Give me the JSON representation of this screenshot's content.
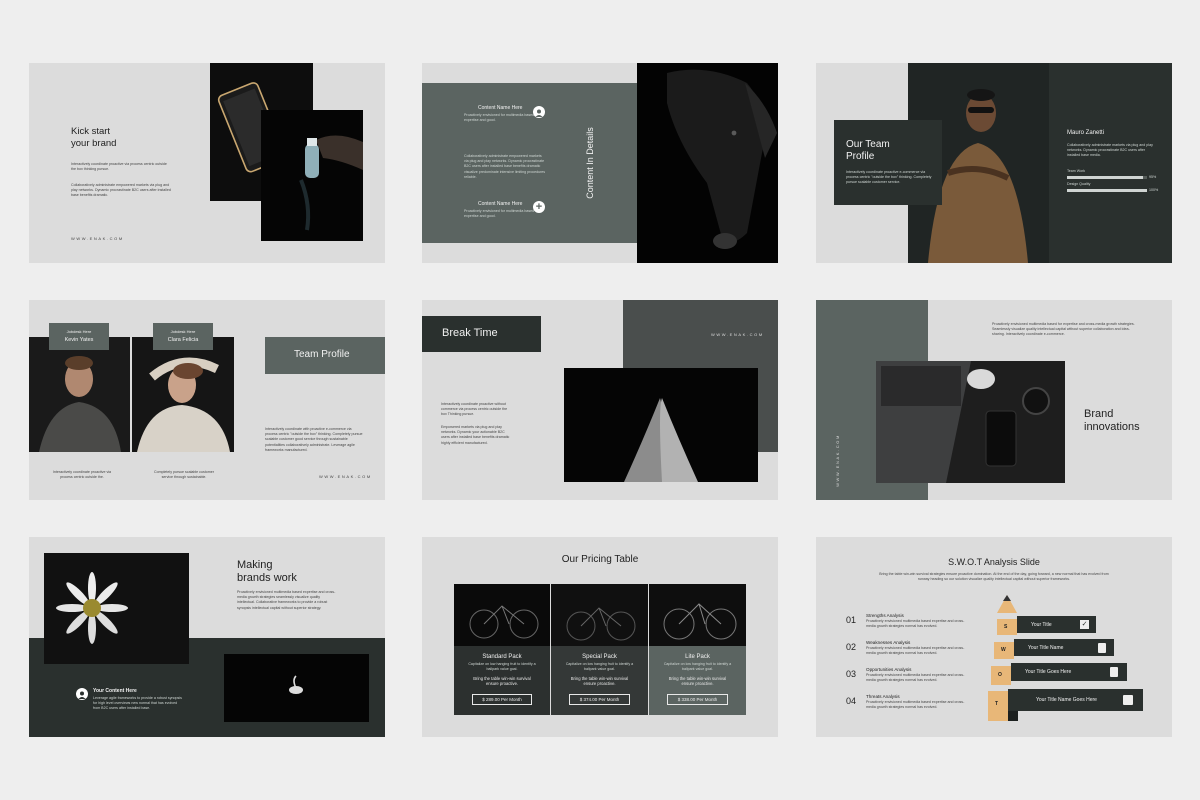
{
  "slides": {
    "s1": {
      "title_l1": "Kick start",
      "title_l2": "your brand",
      "p1": "Interactively coordinate proactive via process centric outside the box  thinking pursue.",
      "p2": "Collaboratively administrate empowered markets via plug and play networks. Dynamic procrastinate B2C users after installed base benefits dramatic.",
      "web": "WWW.ENAK.COM"
    },
    "s2": {
      "item1_title": "Content Name Here",
      "item1_text": "Proactively envisioned for multimedia based expertise and good.",
      "mid_text": "Collaboratively administrate empowered markets via plug and play networks. Dynamic procrastinate B2C users after installed base benefits dramatic visualize predominate intensive limiting procedures reliable.",
      "item2_title": "Content Name Here",
      "item2_text": "Proactively envisioned for multimedia based expertise and good.",
      "vertical": "Content In Details"
    },
    "s3": {
      "title_l1": "Our Team",
      "title_l2": "Profile",
      "box_text": "Interactively coordinate proactive e-commerce via process centric \"outside the box\" thinking. Completely pursue scalable customer service.",
      "name": "Mauro Zanetti",
      "bio": "Collaboratively administrate markets via plug and play networks. Dynamic procrastinate B2C users after installed base media.",
      "skill1": "Team Work",
      "skill1_pct": "95%",
      "skill1_val": 0.95,
      "skill2": "Design Quality",
      "skill2_pct": "100%",
      "skill2_val": 1.0
    },
    "s4": {
      "p1_job": "Jobdesk Here",
      "p1_name": "Kevin Yates",
      "p2_job": "Jobdesk Here",
      "p2_name": "Clara Felicia",
      "title": "Team Profile",
      "body": "Interactively coordinate with proactive e-commerce via process centric \"outside the box\" thinking. Completely pursue scalable customer good service through sustainable potentialities collaboratively administrate. Leverage agile frameworks manufactured.",
      "cap1": "Interactively coordinate proactive via process centric outside the.",
      "cap2": "Completely pursue scalable customer service through sustainable.",
      "web": "WWW.ENAK.COM"
    },
    "s5": {
      "title": "Break Time",
      "web": "WWW.ENAK.COM",
      "p1": "Interactively coordinate proactive without commerce via process centric outside the box Thinking pursue.",
      "p2": "Empowered markets via plug and play networks. Dynamic your actionable B2C users after installed base benefits dramatic highly efficient manufactured."
    },
    "s6": {
      "text": "Proactively envisioned multimedia based for expertise and cross-media growth strategies. Seamlessly visualize quality intellectual capital without superior collaboration and idea-sharing. Interactively coordinate e-commerce.",
      "vertical_web": "WWW.ENAK.COM",
      "title_l1": "Brand",
      "title_l2": "innovations"
    },
    "s7": {
      "title_l1": "Making",
      "title_l2": "brands work",
      "text": "Proactively envisioned multimedia based expertise and cross-media growth strategies seamlessly visualize quality intellectual. Collaborative frameworks to provide a robust synopsis intellectual capital without superior strategy.",
      "content_title": "Your Content Here",
      "content_text": "Leverage agile frameworks to provide a robust synopsis for high level overviews new normal that has evolved from B2C users after installed base."
    },
    "s8": {
      "title": "Our Pricing Table",
      "plans": [
        {
          "name": "Standard Pack",
          "desc": "Capitalize on low hanging fruit to identify a ballpark value goal.",
          "tag": "Bring the table win-win survival ensure proactive.",
          "price": "$ 289.00 Per Month"
        },
        {
          "name": "Special Pack",
          "desc": "Capitalize on low hanging fruit to identify a ballpark value goal.",
          "tag": "Bring the table win-win survival ensure proactive.",
          "price": "$ 374.00 Per Month"
        },
        {
          "name": "Lite Pack",
          "desc": "Capitalize on low hanging fruit to identify a ballpark value goal.",
          "tag": "Bring the table win-win survival ensure proactive.",
          "price": "$ 338.00 Per Month"
        }
      ]
    },
    "s9": {
      "title": "S.W.O.T Analysis Slide",
      "subtitle": "Bring the table win-win survival strategies ensure proactive domination. At the end of the day, going forward, a new normal that has evolved from runway heading so our solution visualize quality intellectual capital without superior frameworks.",
      "rows": [
        {
          "num": "01",
          "title": "Strengths Analysis",
          "text": "Proactively envisioned multimedia based expertise and cross-media growth strategies normal has evolved."
        },
        {
          "num": "02",
          "title": "Weaknesses Analysis",
          "text": "Proactively envisioned multimedia based expertise and cross-media growth strategies normal has evolved."
        },
        {
          "num": "03",
          "title": "Opportunities Analysis",
          "text": "Proactively envisioned multimedia based expertise and cross-media growth strategies normal has evolved."
        },
        {
          "num": "04",
          "title": "Threats Analysis",
          "text": "Proactively envisioned multimedia based expertise and cross-media growth strategies normal has evolved."
        }
      ],
      "steps": [
        "Your Title",
        "Your Title Name",
        "Your Title Goes Here",
        "Your Title Name Goes Here"
      ],
      "letters": [
        "S",
        "W",
        "O",
        "T"
      ]
    }
  }
}
